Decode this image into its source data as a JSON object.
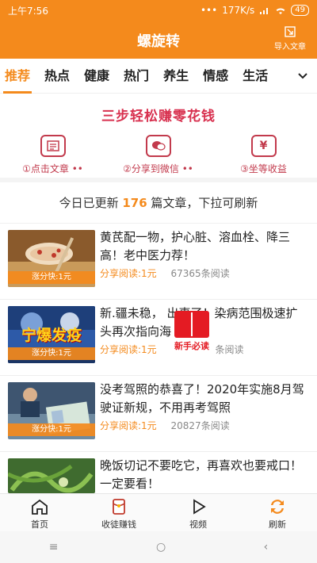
{
  "status_bar": {
    "time": "上午7:56",
    "dots": "•••",
    "speed": "177K/s",
    "battery": "49"
  },
  "header": {
    "title": "螺旋转",
    "import_label": "导入文章"
  },
  "tabs": [
    {
      "label": "推荐",
      "active": true
    },
    {
      "label": "热点"
    },
    {
      "label": "健康"
    },
    {
      "label": "热门"
    },
    {
      "label": "养生"
    },
    {
      "label": "情感"
    },
    {
      "label": "生活"
    }
  ],
  "promo": {
    "headline": "三步轻松赚零花钱",
    "steps": [
      {
        "icon": "article-icon",
        "label": "①点击文章 ••"
      },
      {
        "icon": "wechat-icon",
        "label": "②分享到微信 ••"
      },
      {
        "icon": "yen-icon",
        "symbol": "¥",
        "label": "③坐等收益"
      }
    ]
  },
  "notice": {
    "prefix": "今日已更新 ",
    "count": "176",
    "suffix": " 篇文章，下拉可刷新"
  },
  "articles": [
    {
      "title": "黄芪配一物，护心脏、溶血栓、降三高！老中医力荐！",
      "badge": "涨分快:1元",
      "share": "分享阅读:1元",
      "reads": "67365条阅读"
    },
    {
      "title": "新.疆未稳，    出事了！染病范围极速扩    头再次指向海",
      "thumb_text": "宁爆发疫",
      "badge": "涨分快:1元",
      "share": "分享阅读:1元",
      "reads": "条阅读"
    },
    {
      "title": "没考驾照的恭喜了！2020年实施8月驾驶证新规，不用再考驾照",
      "badge": "涨分快:1元",
      "share": "分享阅读:1元",
      "reads": "20827条阅读"
    },
    {
      "title": "晚饭切记不要吃它，再喜欢也要戒口！一定要看！"
    }
  ],
  "floating_badge": {
    "label": "新手必读"
  },
  "bottom_nav": [
    {
      "label": "首页"
    },
    {
      "label": "收徒赚钱"
    },
    {
      "label": "视频"
    },
    {
      "label": "刷新"
    }
  ],
  "system_nav": {
    "menu": "≡",
    "home": "○",
    "back": "‹"
  },
  "colors": {
    "brand": "#f48a1c",
    "promo_red": "#c23a4c",
    "badge_red": "#e41b23"
  }
}
